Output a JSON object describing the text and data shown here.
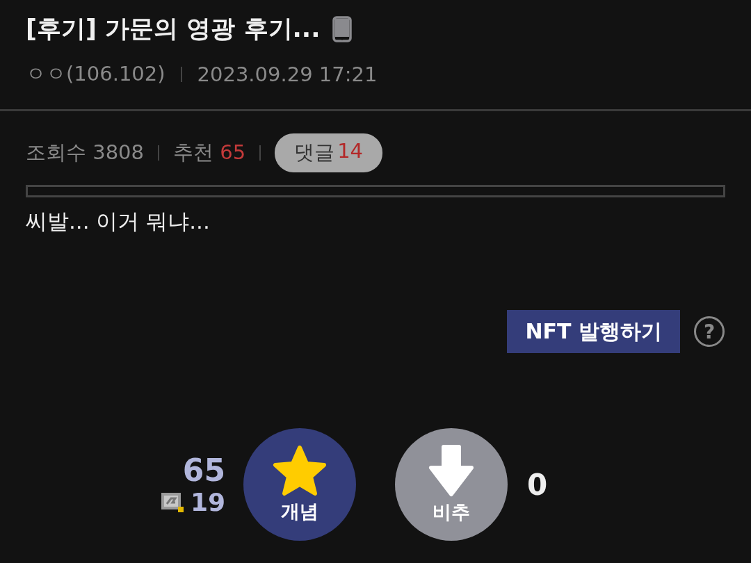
{
  "post": {
    "title": "[후기] 가문의 영광 후기...",
    "author": "ㅇㅇ(106.102)",
    "date": "2023.09.29 17:21"
  },
  "stats": [
    {
      "label": "조회수",
      "value": "3808",
      "kind": "plain"
    },
    {
      "label": "추천",
      "value": "65",
      "kind": "plain"
    },
    {
      "label": "댓글",
      "value": "14",
      "kind": "pill"
    }
  ],
  "body": "씨발... 이거 뭐냐...",
  "nft_button": "NFT 발행하기",
  "help": "?",
  "votes": {
    "up_count": "65",
    "fixed_count": "19",
    "up_label": "개념",
    "down_label": "비추",
    "down_count": "0"
  }
}
